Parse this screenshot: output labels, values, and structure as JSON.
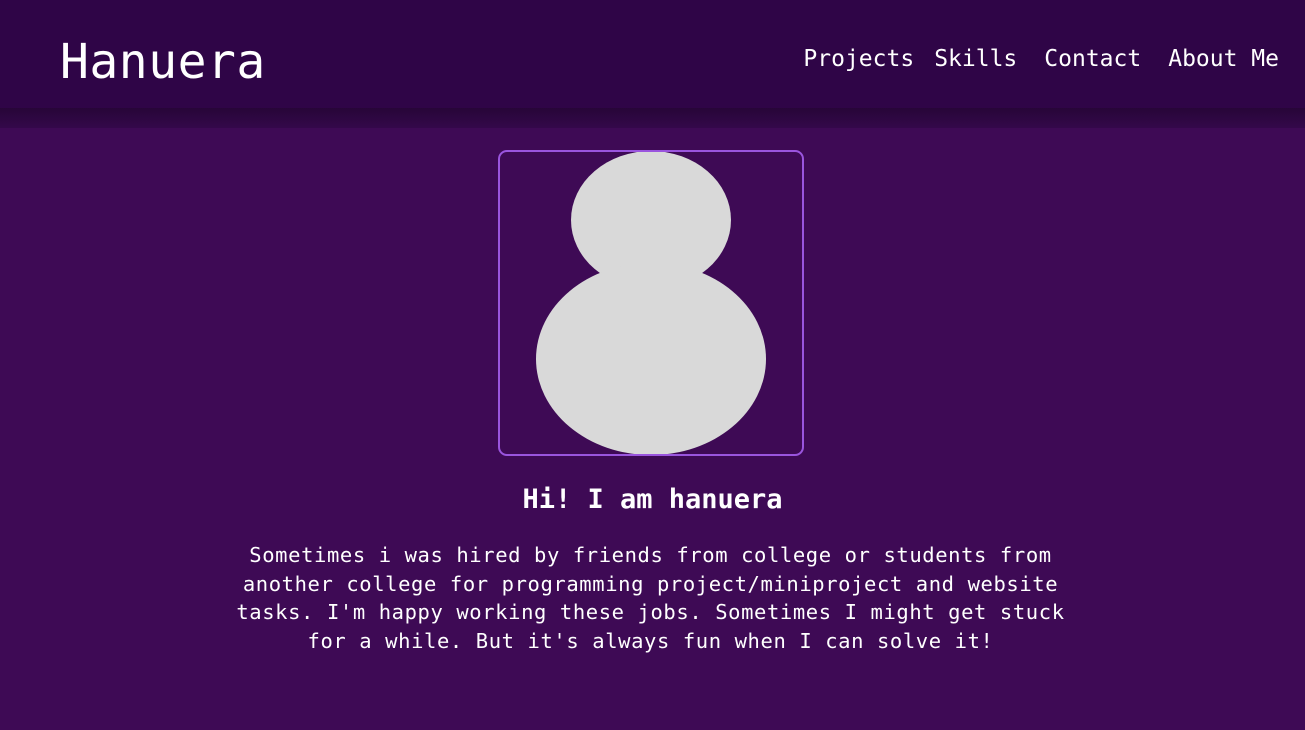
{
  "header": {
    "brand": "Hanuera",
    "nav": {
      "projects": "Projects",
      "skills": "Skills",
      "contact": "Contact",
      "about": "About Me"
    }
  },
  "hero": {
    "avatar_icon": "person-silhouette-icon",
    "headline": "Hi! I am hanuera",
    "bio": "Sometimes i was hired by friends from college or students from another college for programming project/miniproject and website tasks. I'm happy working these jobs. Sometimes I might get stuck for a while. But it's always fun when I can solve it!"
  },
  "colors": {
    "background": "#3e0a55",
    "header": "#2f0547",
    "frame_border": "#9a55de",
    "avatar": "#d9d9d9",
    "text": "#ffffff"
  }
}
